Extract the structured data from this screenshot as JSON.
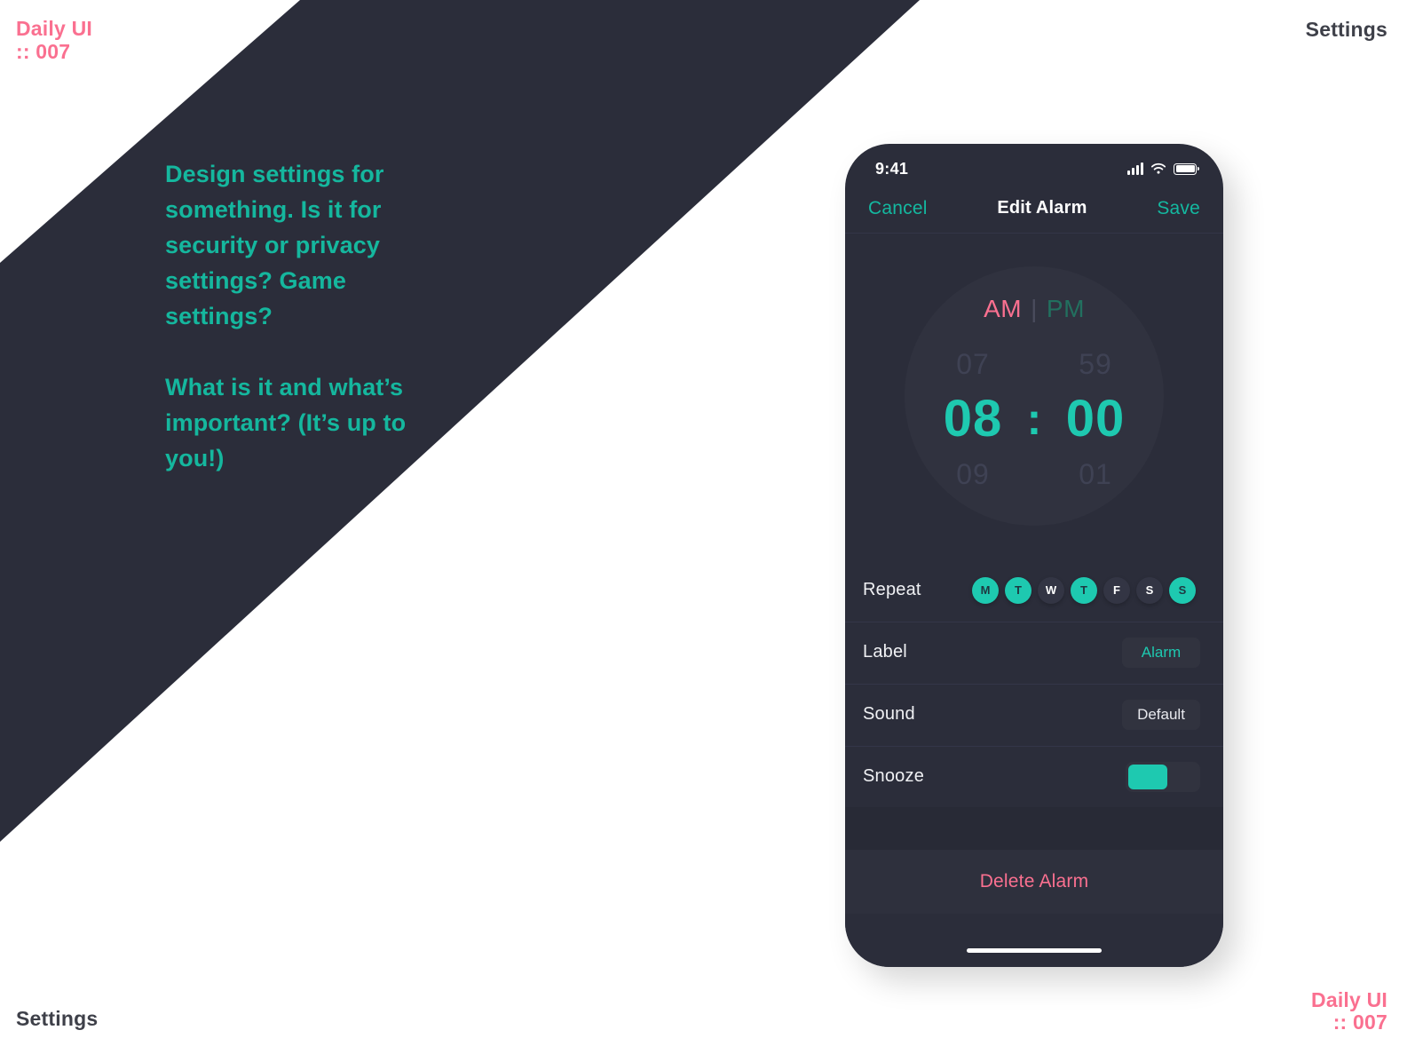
{
  "page": {
    "background_color": "#ffffff",
    "band_color": "#2b2d3a",
    "accent_teal": "#1ec9b0",
    "accent_pink": "#fa7090",
    "dark_text": "#3e4049"
  },
  "corners": {
    "top_left": {
      "line1": "Daily UI",
      "line2": ":: 007"
    },
    "top_right": "Settings",
    "bottom_left": "Settings",
    "bottom_right": {
      "line1": "Daily UI",
      "line2": ":: 007"
    }
  },
  "brief": {
    "paragraph_1": "Design settings for something. Is it for security or privacy settings? Game settings?",
    "paragraph_2": "What is it and what’s important? (It’s up to you!)"
  },
  "phone": {
    "status_bar": {
      "time": "9:41",
      "icons": [
        "signal-icon",
        "wifi-icon",
        "battery-icon"
      ]
    },
    "navbar": {
      "cancel_label": "Cancel",
      "title": "Edit Alarm",
      "save_label": "Save"
    },
    "time_picker": {
      "am_label": "AM",
      "separator": "|",
      "pm_label": "PM",
      "selected_meridiem": "AM",
      "hour_previous": "07",
      "hour_selected": "08",
      "hour_next": "09",
      "colon": ":",
      "minute_previous": "59",
      "minute_selected": "00",
      "minute_next": "01"
    },
    "settings_rows": {
      "repeat": {
        "label": "Repeat",
        "days": [
          {
            "letter": "M",
            "active": true
          },
          {
            "letter": "T",
            "active": true
          },
          {
            "letter": "W",
            "active": false
          },
          {
            "letter": "T",
            "active": true
          },
          {
            "letter": "F",
            "active": false
          },
          {
            "letter": "S",
            "active": false
          },
          {
            "letter": "S",
            "active": true
          }
        ]
      },
      "label": {
        "label": "Label",
        "value": "Alarm"
      },
      "sound": {
        "label": "Sound",
        "value": "Default"
      },
      "snooze": {
        "label": "Snooze",
        "enabled": true
      }
    },
    "delete_label": "Delete Alarm",
    "home_indicator": "home-indicator"
  }
}
